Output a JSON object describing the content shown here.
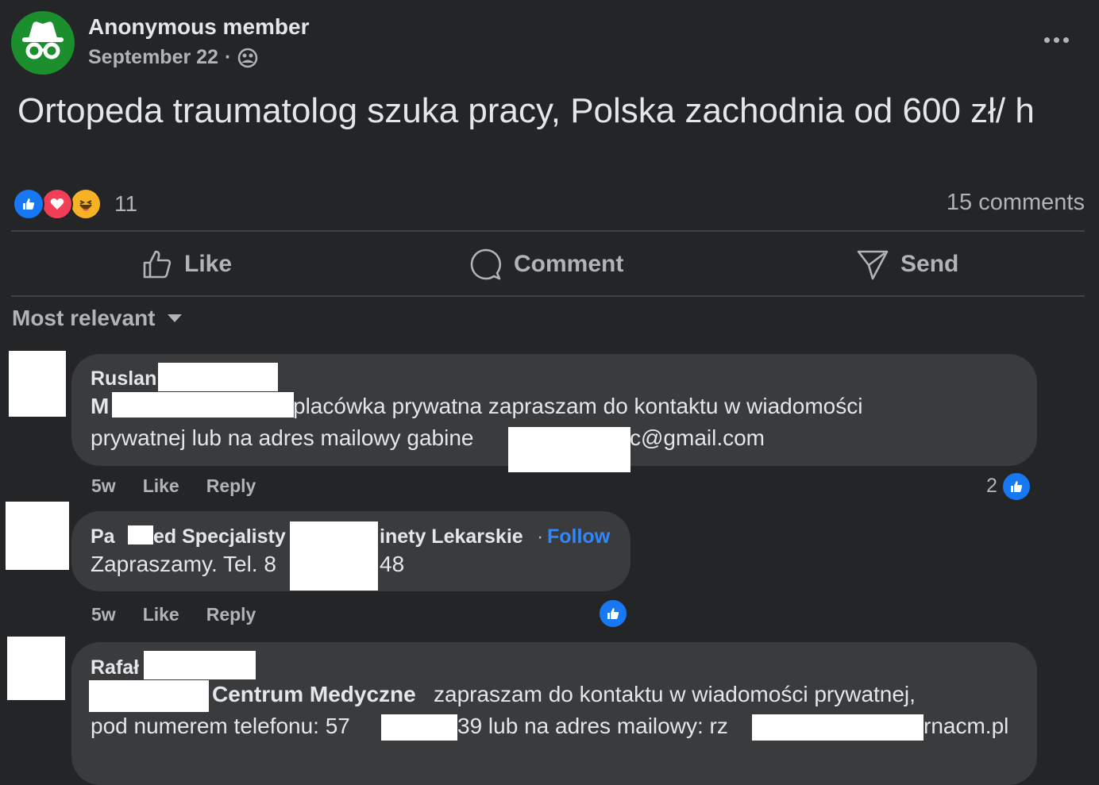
{
  "post": {
    "author": "Anonymous member",
    "date": "September 22",
    "separator": "·",
    "audience_icon": "group-icon",
    "text": "Ortopeda traumatolog szuka pracy, Polska zachodnia od 600 zł/ h",
    "reaction_count": "11",
    "reactions": [
      "like-icon",
      "love-icon",
      "haha-icon"
    ],
    "comments_count": "15 comments"
  },
  "actions": {
    "like": "Like",
    "comment": "Comment",
    "send": "Send"
  },
  "sort": {
    "label": "Most relevant"
  },
  "comments": [
    {
      "name": "Ruslan",
      "line1_prefix": "M",
      "line1_rest": "placówka prywatna zapraszam do kontaktu w wiadomości",
      "line2_prefix": "prywatnej lub na adres mailowy gabine",
      "line2_rest": "c@gmail.com",
      "time": "5w",
      "like": "Like",
      "reply": "Reply",
      "like_count": "2"
    },
    {
      "name_start": "Pa",
      "name_mid": "ed Specjalisty",
      "name_end": "inety Lekarskie",
      "separator": "·",
      "follow": "Follow",
      "text_prefix": "Zapraszamy. Tel. 8",
      "text_end": "48",
      "time": "5w",
      "like": "Like",
      "reply": "Reply"
    },
    {
      "name": "Rafał",
      "line1_bold": "Centrum Medyczne",
      "line1_rest": " zapraszam do kontaktu w wiadomości prywatnej,",
      "line2_prefix": "pod numerem telefonu: 57",
      "line2_mid": "39 lub na adres mailowy: rz",
      "line2_end": "rnacm.pl"
    }
  ],
  "colors": {
    "background": "#242526",
    "bubble": "#3a3b3c",
    "text": "#e4e6eb",
    "muted": "#b0b3b8",
    "accent": "#2d88ff",
    "like_blue": "#1877f2",
    "avatar_green": "#1b8f2e"
  }
}
